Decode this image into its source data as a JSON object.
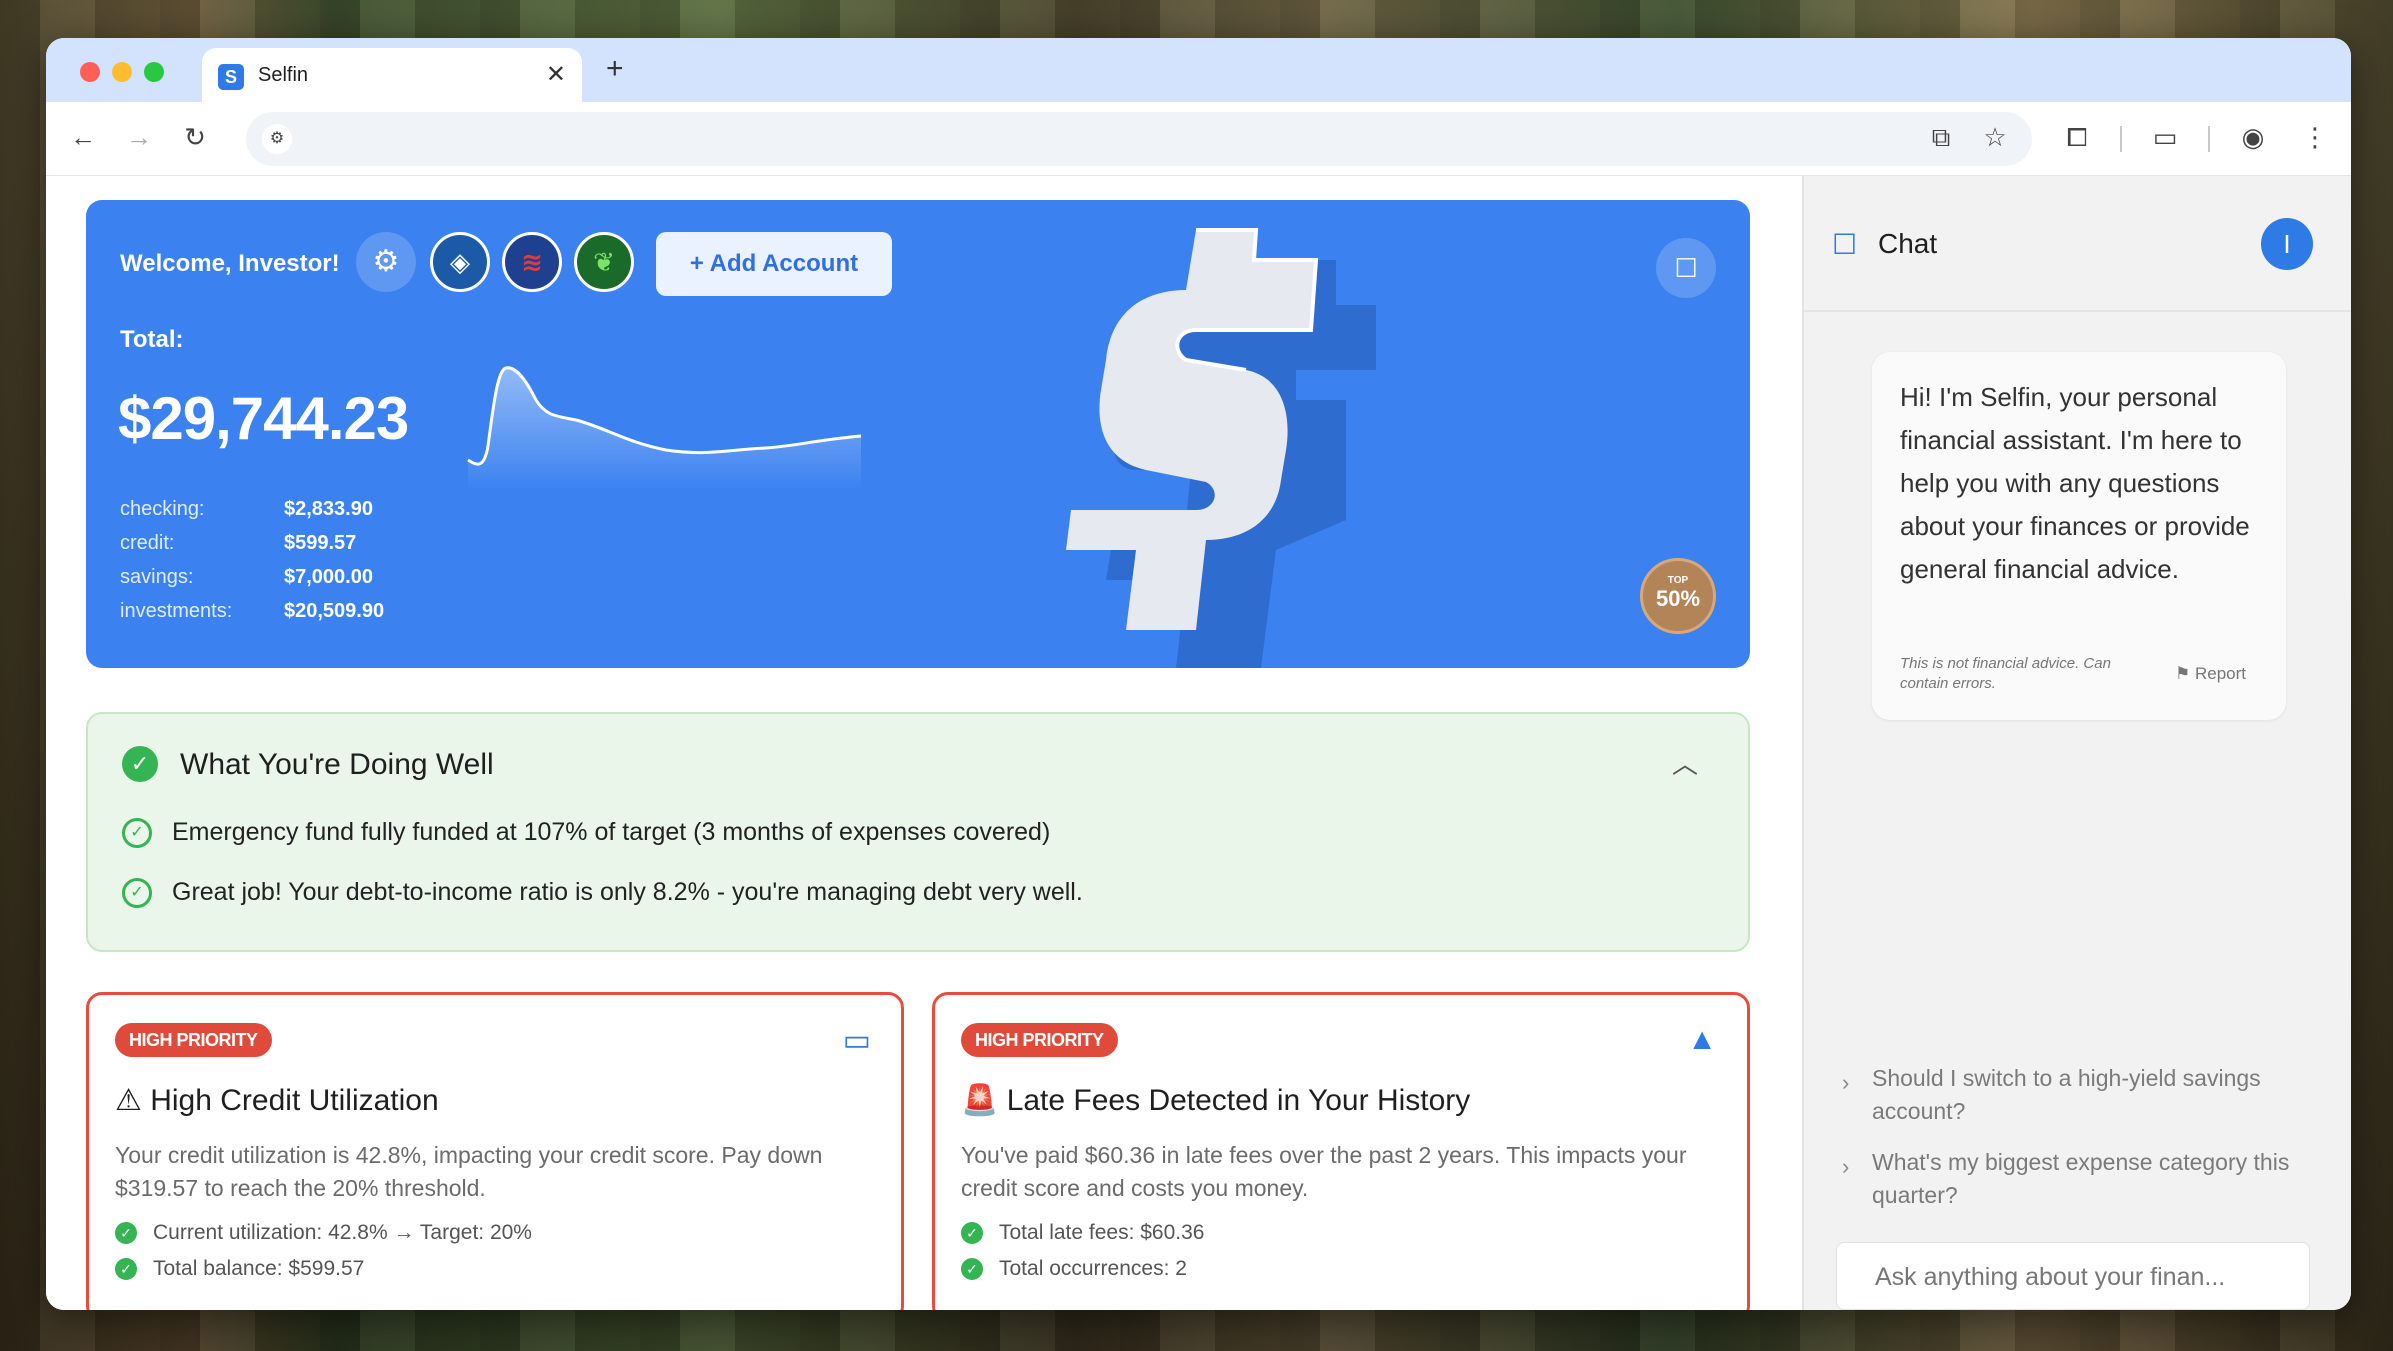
{
  "browser": {
    "tab_title": "Selfin",
    "tab_close": "✕",
    "new_tab": "+",
    "favicon_letter": "S"
  },
  "hero": {
    "welcome": "Welcome, Investor!",
    "add_account": "+ Add Account",
    "total_label": "Total:",
    "total_value": "$29,744.23",
    "accounts": [
      {
        "label": "checking:",
        "value": "$2,833.90"
      },
      {
        "label": "credit:",
        "value": "$599.57"
      },
      {
        "label": "savings:",
        "value": "$7,000.00"
      },
      {
        "label": "investments:",
        "value": "$20,509.90"
      }
    ],
    "badge_top": "TOP",
    "badge_value": "50%"
  },
  "doing_well": {
    "title": "What You're Doing Well",
    "items": [
      "Emergency fund fully funded at 107% of target (3 months of expenses covered)",
      "Great job! Your debt-to-income ratio is only 8.2% - you're managing debt very well."
    ]
  },
  "cards": [
    {
      "badge": "HIGH PRIORITY",
      "title": "⚠ High Credit Utilization",
      "description": "Your credit utilization is 42.8%, impacting your credit score. Pay down $319.57 to reach the 20% threshold.",
      "bullets": [
        "Current utilization: 42.8% → Target: 20%",
        "Total balance: $599.57"
      ],
      "icon": "credit-card-icon"
    },
    {
      "badge": "HIGH PRIORITY",
      "title": "🚨 Late Fees Detected in Your History",
      "description": "You've paid $60.36 in late fees over the past 2 years. This impacts your credit score and costs you money.",
      "bullets": [
        "Total late fees: $60.36",
        "Total occurrences: 2"
      ],
      "icon": "warning-icon"
    }
  ],
  "chat": {
    "title": "Chat",
    "avatar_letter": "I",
    "message": "Hi! I'm Selfin, your personal financial assistant. I'm here to help you with any questions about your finances or provide general financial advice.",
    "disclaimer": "This is not financial advice. Can contain errors.",
    "report": "Report",
    "suggestions": [
      "Should I switch to a high-yield savings account?",
      "What's my biggest expense category this quarter?"
    ],
    "input_placeholder": "Ask anything about your finan..."
  },
  "colors": {
    "accent": "#3b82f0",
    "success": "#34b453",
    "danger": "#e04a3a"
  }
}
